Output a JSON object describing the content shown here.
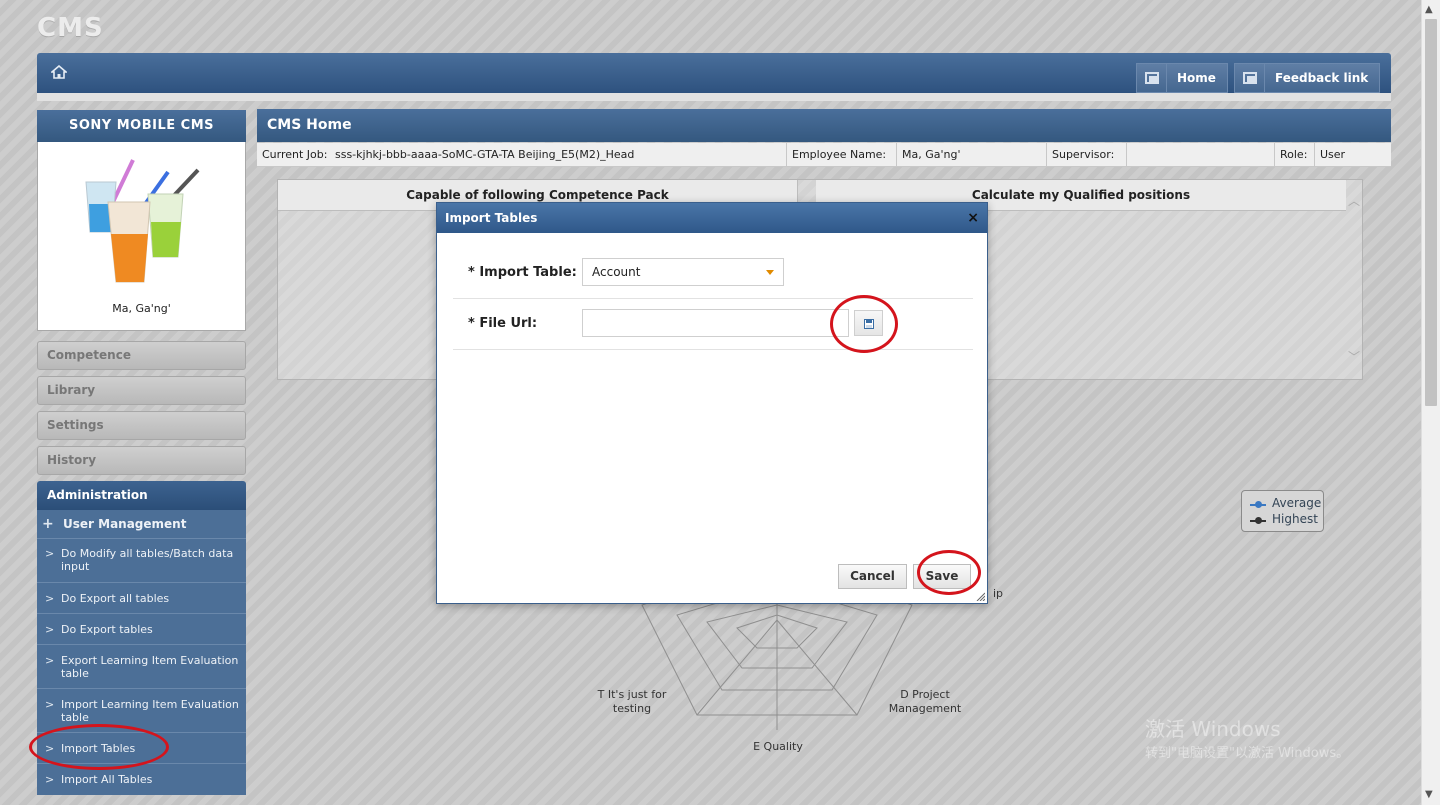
{
  "app": {
    "logo": "CMS"
  },
  "topnav": {
    "home_button": "Home",
    "feedback_button": "Feedback link"
  },
  "profile": {
    "title": "SONY MOBILE CMS",
    "name": "Ma, Ga'ng'"
  },
  "sidebar": {
    "items": [
      {
        "label": "Competence"
      },
      {
        "label": "Library"
      },
      {
        "label": "Settings"
      },
      {
        "label": "History"
      }
    ],
    "admin": {
      "title": "Administration",
      "user_management": "User Management",
      "user_management_marker": "+",
      "chevron": ">",
      "items": [
        {
          "label": "Do Modify all tables/Batch data input"
        },
        {
          "label": "Do Export all tables"
        },
        {
          "label": "Do Export tables"
        },
        {
          "label": "Export Learning Item Evaluation table"
        },
        {
          "label": "Import Learning Item Evaluation table"
        },
        {
          "label": "Import Tables"
        },
        {
          "label": "Import All Tables"
        }
      ]
    }
  },
  "main": {
    "title": "CMS Home",
    "job_bar": {
      "current_job_label": "Current Job:",
      "current_job_value": "sss-kjhkj-bbb-aaaa-SoMC-GTA-TA Beijing_E5(M2)_Head",
      "employee_label": "Employee Name:",
      "employee_value": "Ma, Ga'ng'",
      "supervisor_label": "Supervisor:",
      "supervisor_value": "",
      "role_label": "Role:",
      "role_value": "User"
    },
    "grid": {
      "col1_header": "Capable of following Competence Pack",
      "col2_header": "Calculate my Qualified positions"
    },
    "radar": {
      "labels": [
        "T It's just for testing",
        "D Project Management",
        "E Quality",
        "ip"
      ]
    },
    "legend": {
      "items": [
        {
          "label": "Average",
          "color": "#3a78c2"
        },
        {
          "label": "Highest",
          "color": "#333333"
        }
      ]
    },
    "watermark": {
      "line1": "激活 Windows",
      "line2": "转到\"电脑设置\"以激活 Windows。"
    }
  },
  "modal": {
    "title": "Import Tables",
    "close_glyph": "×",
    "import_table_label": "* Import Table:",
    "import_table_value": "Account",
    "file_url_label": "* File Url:",
    "file_url_value": "",
    "cancel_label": "Cancel",
    "save_label": "Save"
  }
}
